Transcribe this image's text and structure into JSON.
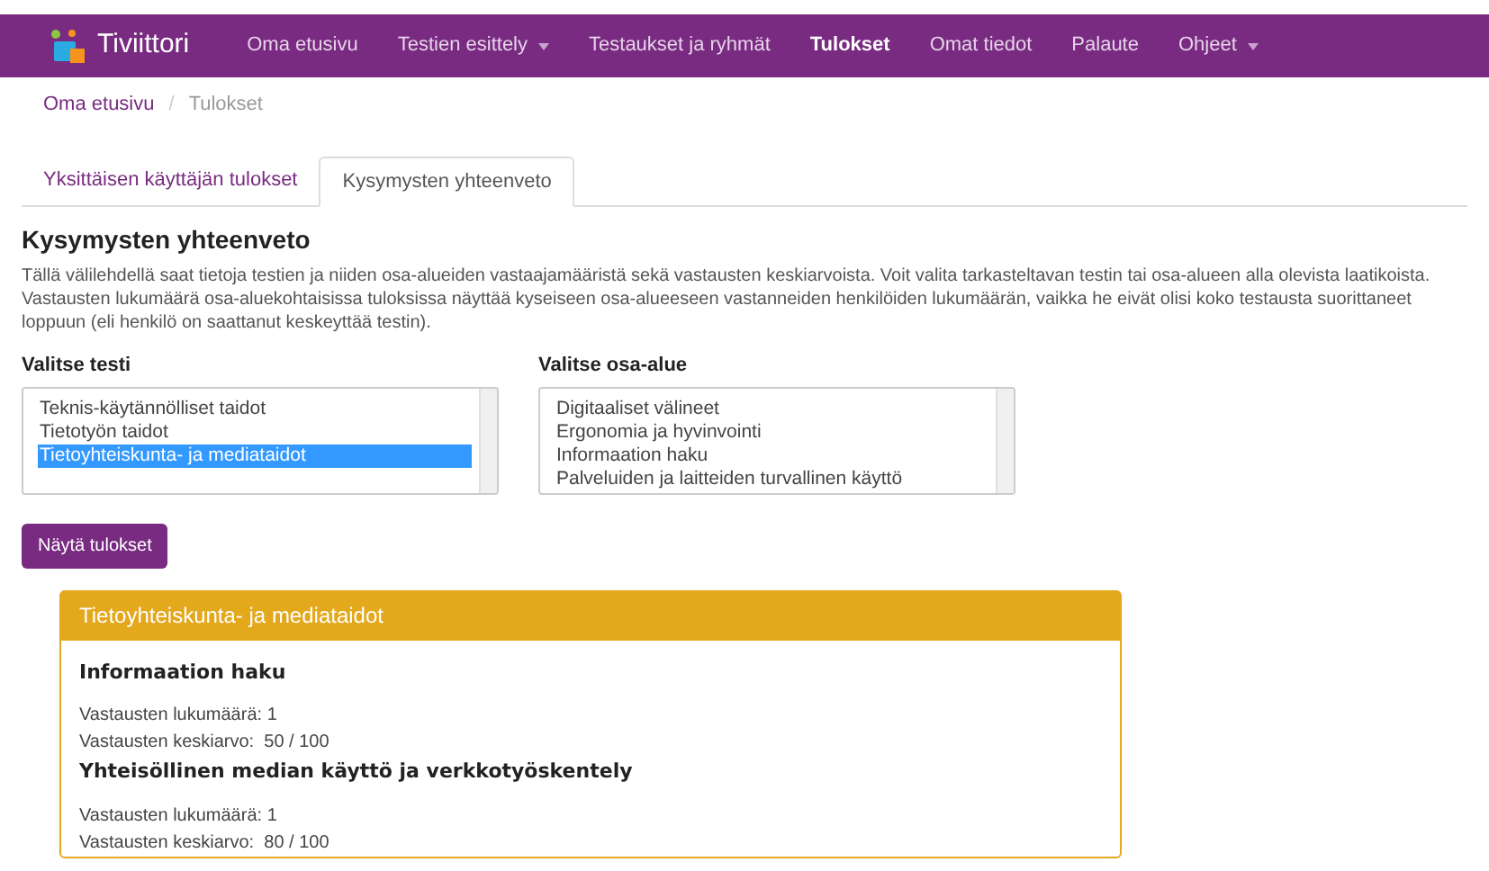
{
  "navbar": {
    "brand": "Tiviittori",
    "items": [
      {
        "label": "Oma etusivu",
        "selected": false,
        "dropdown": false
      },
      {
        "label": "Testien esittely",
        "selected": false,
        "dropdown": true
      },
      {
        "label": "Testaukset ja ryhmät",
        "selected": false,
        "dropdown": false
      },
      {
        "label": "Tulokset",
        "selected": true,
        "dropdown": false
      },
      {
        "label": "Omat tiedot",
        "selected": false,
        "dropdown": false
      },
      {
        "label": "Palaute",
        "selected": false,
        "dropdown": false
      },
      {
        "label": "Ohjeet",
        "selected": false,
        "dropdown": true
      }
    ]
  },
  "breadcrumb_separator": "/",
  "breadcrumb": [
    {
      "label": "Oma etusivu",
      "link": true
    },
    {
      "label": "Tulokset",
      "link": false
    }
  ],
  "tabs": [
    {
      "label": "Yksittäisen käyttäjän tulokset",
      "selected": false
    },
    {
      "label": "Kysymysten yhteenveto",
      "selected": true
    }
  ],
  "heading": "Kysymysten yhteenveto",
  "paragraphs": [
    "Tällä välilehdellä saat tietoja testien ja niiden osa-alueiden vastaajamääristä sekä vastausten keskiarvoista. Voit valita tarkasteltavan testin tai osa-alueen alla olevista laatikoista.",
    "Vastausten lukumäärä osa-aluekohtaisissa tuloksissa näyttää kyseiseen osa-alueeseen vastanneiden henkilöiden lukumäärän, vaikka he eivät olisi koko testausta suorittaneet loppuun (eli henkilö on saattanut keskeyttää testin)."
  ],
  "selects": [
    {
      "label": "Valitse testi",
      "options": [
        {
          "label": "Teknis-käytännölliset taidot",
          "selected": false
        },
        {
          "label": "Tietotyön taidot",
          "selected": false
        },
        {
          "label": "Tietoyhteiskunta- ja mediataidot",
          "selected": true
        }
      ]
    },
    {
      "label": "Valitse osa-alue",
      "options": [
        {
          "label": "Digitaaliset välineet",
          "selected": false
        },
        {
          "label": "Ergonomia ja hyvinvointi",
          "selected": false
        },
        {
          "label": "Informaation haku",
          "selected": false
        },
        {
          "label": "Palveluiden ja laitteiden turvallinen käyttö",
          "selected": false
        }
      ]
    }
  ],
  "show_button": "Näytä tulokset",
  "panel": {
    "title": "Tietoyhteiskunta- ja mediataidot",
    "sections": [
      {
        "title": "Informaation haku",
        "lines": [
          "Vastausten lukumäärä: 1",
          "Vastausten keskiarvo:  50 / 100"
        ]
      },
      {
        "title": "Yhteisöllinen median käyttö ja verkkotyöskentely",
        "lines": [
          "Vastausten lukumäärä: 1",
          "Vastausten keskiarvo:  80 / 100"
        ]
      }
    ]
  }
}
